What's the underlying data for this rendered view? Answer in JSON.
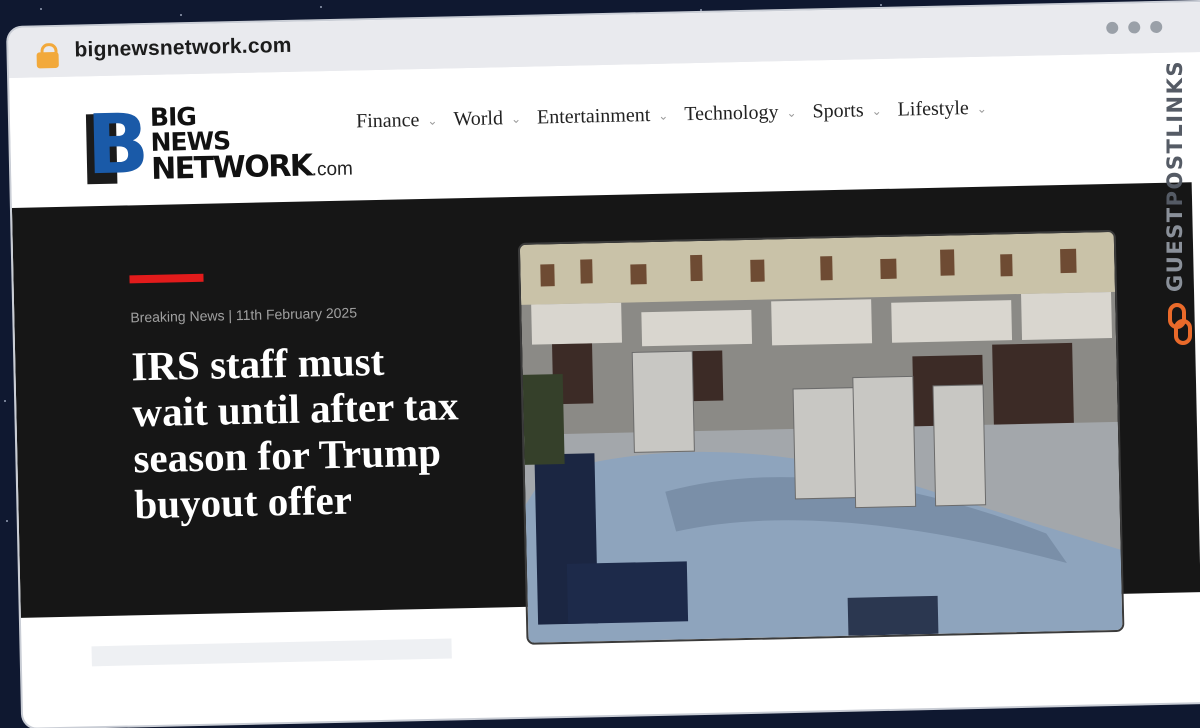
{
  "browser": {
    "url": "bignewsnetwork.com"
  },
  "logo": {
    "line1": "BIG",
    "line2": "NEWS",
    "line3": "NETWORK",
    "suffix": ".com",
    "icon": "big-news-network-b-mark"
  },
  "nav": {
    "items": [
      {
        "label": "Finance"
      },
      {
        "label": "World"
      },
      {
        "label": "Entertainment"
      },
      {
        "label": "Technology"
      },
      {
        "label": "Sports"
      },
      {
        "label": "Lifestyle"
      }
    ],
    "dropdown_icon": "chevron-down-icon"
  },
  "hero": {
    "meta": "Breaking News | 11th February 2025",
    "headline": "IRS staff must wait until after tax season for Trump buyout offer",
    "image_icon": "office-cubicles-photo"
  },
  "watermark": {
    "brand_a": "GUEST",
    "brand_b": "POSTLINKS",
    "icon": "link-icon"
  },
  "colors": {
    "accent_red": "#e21b1b",
    "logo_blue": "#1a5aa8",
    "hero_bg": "#161616",
    "page_bg": "#0f1830",
    "watermark_orange": "#ea6a2a"
  }
}
